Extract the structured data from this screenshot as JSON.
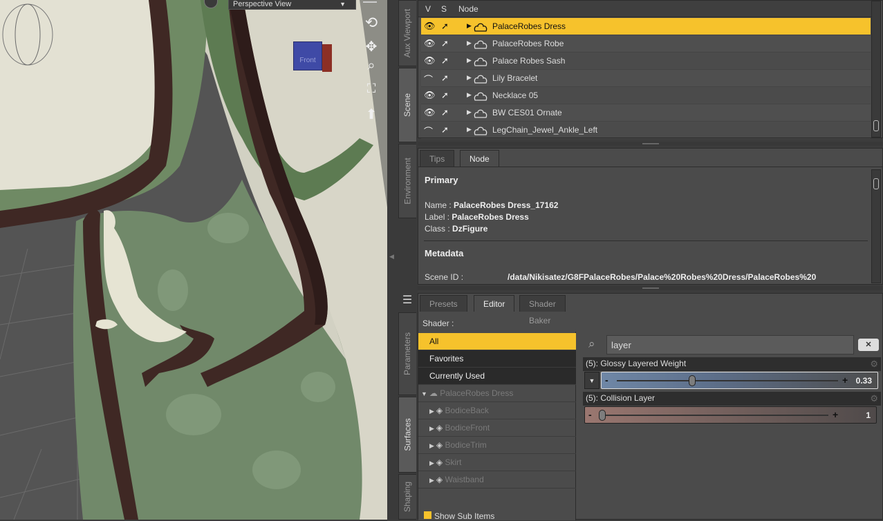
{
  "viewport": {
    "view_label": "Perspective View",
    "dropdown_icon": "chevron-down-icon",
    "navcube_label": "Front",
    "nav_icons": [
      "orbit-icon",
      "pan-icon",
      "zoom-icon",
      "frame-icon",
      "reset-icon"
    ]
  },
  "left_tabs": {
    "aux": "Aux Viewport",
    "scene": "Scene",
    "environment": "Environment",
    "parameters": "Parameters",
    "surfaces": "Surfaces",
    "shaping": "Shaping"
  },
  "scene": {
    "col_v": "V",
    "col_s": "S",
    "col_node": "Node",
    "rows": [
      {
        "name": "PalaceRobes Dress",
        "selected": true,
        "visible": true
      },
      {
        "name": "PalaceRobes Robe",
        "selected": false,
        "visible": true
      },
      {
        "name": "Palace Robes Sash",
        "selected": false,
        "visible": true
      },
      {
        "name": "Lily Bracelet",
        "selected": false,
        "visible": false
      },
      {
        "name": "Necklace 05",
        "selected": false,
        "visible": true
      },
      {
        "name": "BW CES01 Ornate",
        "selected": false,
        "visible": true
      },
      {
        "name": "LegChain_Jewel_Ankle_Left",
        "selected": false,
        "visible": false
      }
    ]
  },
  "node_pane": {
    "tabs": [
      "Tips",
      "Node"
    ],
    "section_primary": "Primary",
    "name_label": "Name :",
    "name_value": "PalaceRobes Dress_17162",
    "label_label": "Label :",
    "label_value": "PalaceRobes Dress",
    "class_label": "Class :",
    "class_value": "DzFigure",
    "section_metadata": "Metadata",
    "scene_id_label": "Scene ID :",
    "scene_id_value": "/data/Nikisatez/G8FPalaceRobes/Palace%20Robes%20Dress/PalaceRobes%20"
  },
  "surfaces": {
    "tabs": [
      "Presets",
      "Editor",
      "Shader Baker"
    ],
    "shader_label": "Shader :",
    "list": [
      "All",
      "Favorites",
      "Currently Used"
    ],
    "figure": "PalaceRobes Dress",
    "materials": [
      "BodiceBack",
      "BodiceFront",
      "BodiceTrim",
      "Skirt",
      "Waistband"
    ],
    "show_sub_items": "Show Sub Items",
    "search_value": "layer",
    "properties": [
      {
        "label": "(5): Glossy Layered Weight",
        "value": "0.33",
        "fraction": 0.33
      },
      {
        "label": "(5): Collision Layer",
        "value": "1",
        "fraction": 0.0
      }
    ]
  },
  "colors": {
    "selection": "#f6c22c",
    "panel": "#4b4b4b",
    "dark_item": "#2a2a2a"
  }
}
